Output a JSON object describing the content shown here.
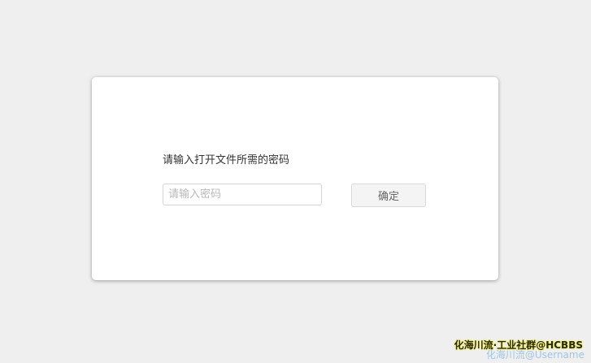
{
  "dialog": {
    "prompt": "请输入打开文件所需的密码",
    "password_placeholder": "请输入密码",
    "password_value": "",
    "confirm_label": "确定"
  },
  "watermark": {
    "main": "化海川流·工业社群@HCBBS",
    "sub": "化海川流@Username"
  }
}
